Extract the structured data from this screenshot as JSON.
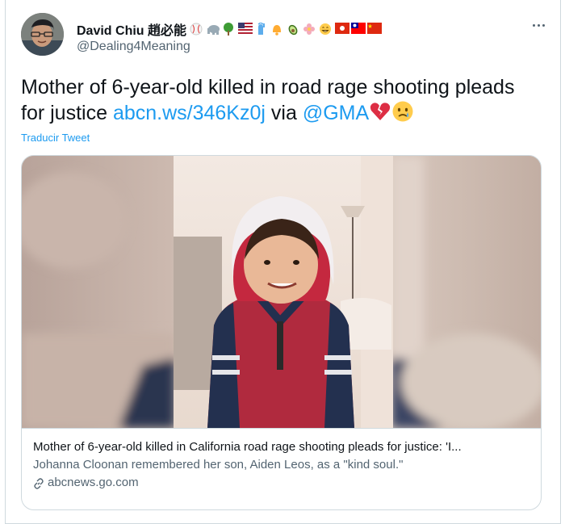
{
  "tweet": {
    "author": {
      "display_name": "David Chiu 趙必能",
      "handle": "@Dealing4Meaning",
      "name_emojis": [
        "baseball-emoji",
        "elephant-emoji",
        "tree-emoji",
        "us-flag-emoji",
        "statue-of-liberty-emoji",
        "bell-emoji",
        "avocado-emoji",
        "flower-emoji",
        "smiling-face-emoji",
        "hong-kong-flag-emoji",
        "taiwan-flag-emoji",
        "china-flag-emoji"
      ]
    },
    "text_before_link": "Mother of 6-year-old killed in road rage shooting pleads for justice ",
    "link_text": "abcn.ws/346Kz0j",
    "text_via": " via ",
    "mention": "@GMA",
    "trailing_emojis": [
      "broken-heart-emoji",
      "crying-face-emoji"
    ],
    "translate_label": "Traducir Tweet",
    "more_icon": "more-dots-icon"
  },
  "card": {
    "title": "Mother of 6-year-old killed in California road rage shooting pleads for justice: 'I...",
    "description": "Johanna Cloonan remembered her son, Aiden Leos, as a \"kind soul.\"",
    "domain": "abcnews.go.com",
    "domain_icon": "link-icon"
  },
  "colors": {
    "link": "#1d9bf0",
    "text": "#0f1419",
    "secondary": "#536471",
    "border": "#cfd9de"
  }
}
